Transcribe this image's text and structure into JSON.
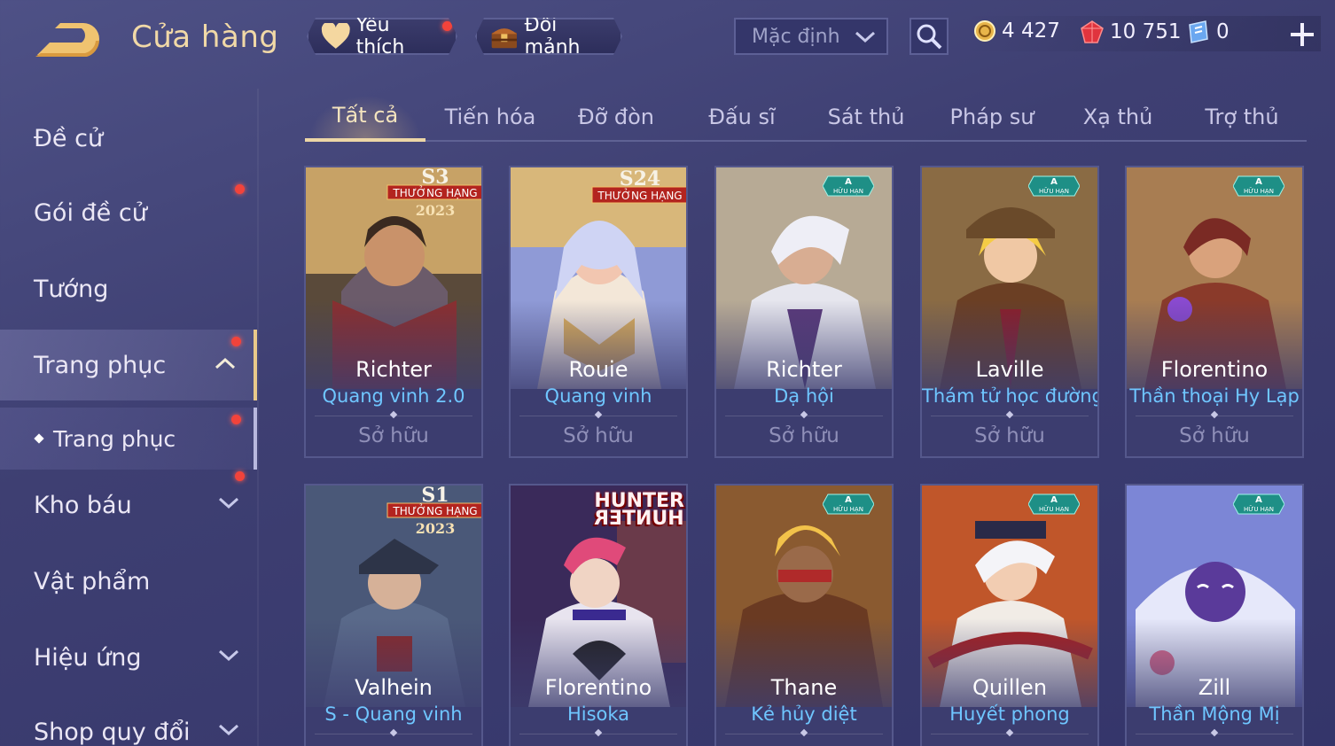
{
  "header": {
    "title": "Cửa hàng",
    "favorites_label": "Yêu thích",
    "shards_label": "Đổi mảnh",
    "sort_label": "Mặc định",
    "currencies": [
      {
        "name": "gold-coin-icon",
        "value": "4 427"
      },
      {
        "name": "ruby-icon",
        "value": "10 751"
      },
      {
        "name": "voucher-icon",
        "value": "0"
      }
    ]
  },
  "sidebar": {
    "items": [
      {
        "label": "Đề cử"
      },
      {
        "label": "Gói đề cử"
      },
      {
        "label": "Tướng"
      },
      {
        "label": "Trang phục"
      },
      {
        "label": "Trang phục"
      },
      {
        "label": "Kho báu"
      },
      {
        "label": "Vật phẩm"
      },
      {
        "label": "Hiệu ứng"
      },
      {
        "label": "Shop quy đổi"
      }
    ]
  },
  "tabs": [
    "Tất cả",
    "Tiến hóa",
    "Đỡ đòn",
    "Đấu sĩ",
    "Sát thủ",
    "Pháp sư",
    "Xạ thủ",
    "Trợ thủ"
  ],
  "badges": {
    "s3": "S3",
    "s24": "S24",
    "s1": "S1",
    "rank_reward": "THƯỞNG HẠNG",
    "year": "2023",
    "limited_a": "A",
    "limited_text": "HỮU HẠN",
    "hunter": "HUNTER",
    "hunter_mirror": "HUNTER"
  },
  "cards": [
    {
      "hero": "Richter",
      "skin": "Quang vinh 2.0",
      "status": "Sở hữu"
    },
    {
      "hero": "Rouie",
      "skin": "Quang vinh",
      "status": "Sở hữu"
    },
    {
      "hero": "Richter",
      "skin": "Dạ hội",
      "status": "Sở hữu"
    },
    {
      "hero": "Laville",
      "skin": "Thám tử học đường",
      "status": "Sở hữu"
    },
    {
      "hero": "Florentino",
      "skin": "Thần thoại Hy Lạp",
      "status": "Sở hữu"
    },
    {
      "hero": "Valhein",
      "skin": "S - Quang vinh"
    },
    {
      "hero": "Florentino",
      "skin": "Hisoka"
    },
    {
      "hero": "Thane",
      "skin": "Kẻ hủy diệt"
    },
    {
      "hero": "Quillen",
      "skin": "Huyết phong"
    },
    {
      "hero": "Zill",
      "skin": "Thần Mộng Mị"
    }
  ]
}
